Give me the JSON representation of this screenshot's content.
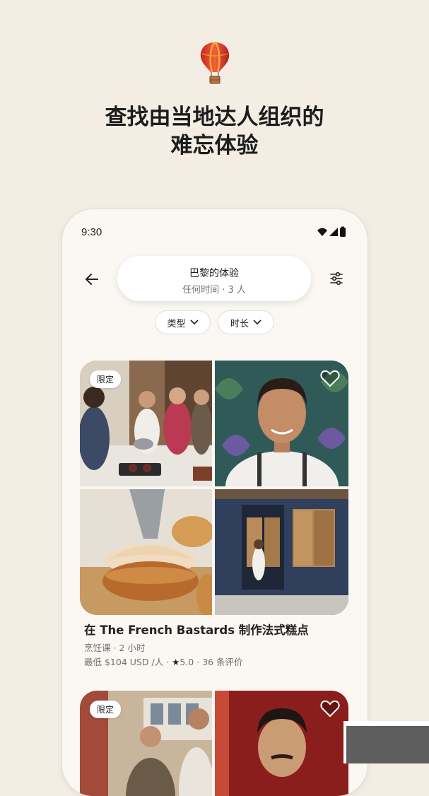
{
  "hero": {
    "icon": "hot-air-balloon-icon",
    "headline_line1": "查找由当地达人组织的",
    "headline_line2": "难忘体验"
  },
  "phone": {
    "status": {
      "time": "9:30",
      "icons": [
        "wifi-icon",
        "signal-icon",
        "battery-icon"
      ]
    },
    "search": {
      "title": "巴黎的体验",
      "subtitle": "任何时间 · 3 人"
    },
    "filters": [
      {
        "label": "类型"
      },
      {
        "label": "时长"
      }
    ],
    "listings": [
      {
        "badge": "限定",
        "title": "在 The French Bastards 制作法式糕点",
        "category": "烹饪课",
        "duration": "2 小时",
        "price": "最低 $104 USD /人",
        "rating": "5.0",
        "reviews": "36 条评价"
      },
      {
        "badge": "限定"
      }
    ]
  },
  "colors": {
    "background": "#f3ede4",
    "phone_bg": "#fbf8f4",
    "text": "#222222",
    "muted": "#6f6f6f"
  }
}
